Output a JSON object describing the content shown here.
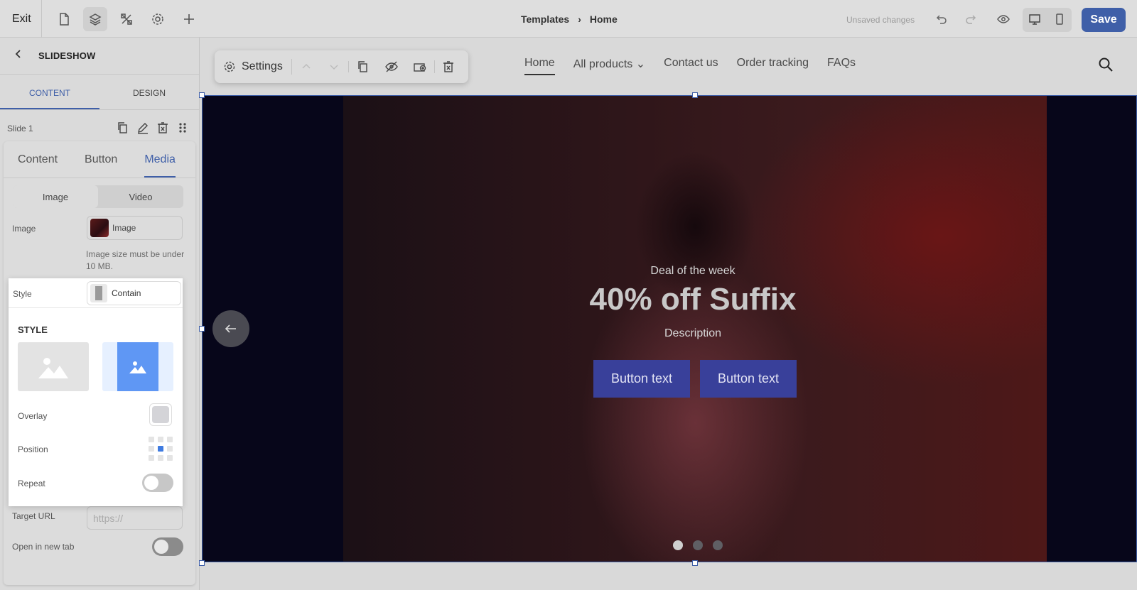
{
  "topbar": {
    "exit_label": "Exit",
    "breadcrumb": [
      "Templates",
      "Home"
    ],
    "status": "Unsaved changes",
    "save_label": "Save"
  },
  "left_panel": {
    "title": "SLIDESHOW",
    "tabs": [
      "CONTENT",
      "DESIGN"
    ],
    "slide_label": "Slide 1",
    "subtabs": [
      "Content",
      "Button",
      "Media"
    ],
    "media_types": [
      "Image",
      "Video"
    ],
    "image_label": "Image",
    "image_value": "Image",
    "image_hint": "Image size must be under 10 MB.",
    "style_label": "Style",
    "style_value": "Contain",
    "target_url_label": "Target URL",
    "target_url_placeholder": "https://",
    "new_tab_label": "Open in new tab"
  },
  "style_popover": {
    "title": "STYLE",
    "overlay_label": "Overlay",
    "position_label": "Position",
    "repeat_label": "Repeat",
    "selected_style": "contain",
    "selected_position": "center",
    "overlay_color": "#d4d4d8"
  },
  "floating_toolbar": {
    "settings_label": "Settings"
  },
  "site_nav": [
    "Home",
    "All products",
    "Contact us",
    "Order tracking",
    "FAQs"
  ],
  "hero": {
    "eyebrow": "Deal of the week",
    "headline": "40% off Suffix",
    "description": "Description",
    "buttons": [
      "Button text",
      "Button text"
    ],
    "active_slide": 1,
    "slide_count": 3
  },
  "colors": {
    "accent": "#3f5fa8",
    "hero_button": "#39409a",
    "position_active": "#3f7be0"
  }
}
